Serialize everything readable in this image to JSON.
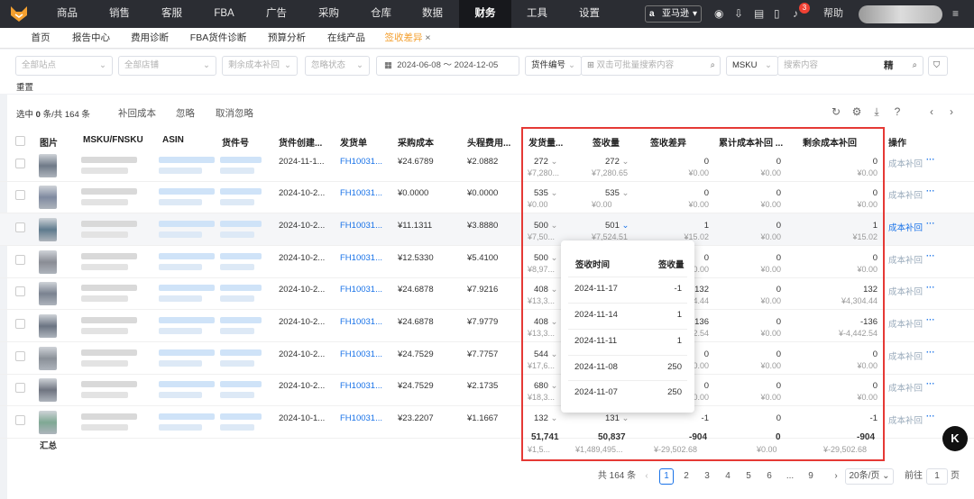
{
  "nav": {
    "items": [
      "商品",
      "销售",
      "客服",
      "FBA",
      "广告",
      "采购",
      "仓库",
      "数据",
      "财务",
      "工具",
      "设置"
    ],
    "active": "财务",
    "region": "亚马逊",
    "help": "帮助",
    "notif_count": "3"
  },
  "tabs": {
    "items": [
      "首页",
      "报告中心",
      "费用诊断",
      "FBA货件诊断",
      "预算分析",
      "在线产品",
      "签收差异"
    ],
    "active_close": "×"
  },
  "filters": {
    "site": "全部站点",
    "shop": "全部店铺",
    "remaining": "剩余成本补回",
    "ignore": "忽略状态",
    "date_start": "2024-06-08",
    "date_sep": "～",
    "date_end": "2024-12-05",
    "shipment_field": "货件编号",
    "batch_placeholder": "双击可批量搜索内容",
    "msku_field": "MSKU",
    "search_placeholder": "搜索内容",
    "exact": "精",
    "reset": "重置"
  },
  "toolbar": {
    "selected": "选中",
    "selected_count": "0",
    "selected_total": "条/共 164 条",
    "recover": "补回成本",
    "ignore": "忽略",
    "cancel_ignore": "取消忽略"
  },
  "columns": [
    "图片",
    "MSKU/FNSKU",
    "ASIN",
    "货件号",
    "货件创建...",
    "发货单",
    "采购成本",
    "头程费用...",
    "发货量...",
    "签收量",
    "签收差异",
    "累计成本补回 ...",
    "剩余成本补回",
    "操作"
  ],
  "rows": [
    {
      "created": "2024-11-1...",
      "order": "FH10031...",
      "cost": "¥24.6789",
      "freight": "¥2.0882",
      "ship": "272",
      "ship_amt": "¥7,280...",
      "recv": "272",
      "recv_amt": "¥7,280.65",
      "diff": "0",
      "diff_amt": "¥0.00",
      "cum": "0",
      "cum_amt": "¥0.00",
      "rem": "0",
      "rem_amt": "¥0.00",
      "op": "成本补回"
    },
    {
      "created": "2024-10-2...",
      "order": "FH10031...",
      "cost": "¥0.0000",
      "freight": "¥0.0000",
      "ship": "535",
      "ship_amt": "¥0.00",
      "recv": "535",
      "recv_amt": "¥0.00",
      "diff": "0",
      "diff_amt": "¥0.00",
      "cum": "0",
      "cum_amt": "¥0.00",
      "rem": "0",
      "rem_amt": "¥0.00",
      "op": "成本补回"
    },
    {
      "created": "2024-10-2...",
      "order": "FH10031...",
      "cost": "¥11.1311",
      "freight": "¥3.8880",
      "ship": "500",
      "ship_amt": "¥7,50...",
      "recv": "501",
      "recv_amt": "¥7,524.51",
      "diff": "1",
      "diff_amt": "¥15.02",
      "cum": "0",
      "cum_amt": "¥0.00",
      "rem": "1",
      "rem_amt": "¥15.02",
      "op": "成本补回"
    },
    {
      "created": "2024-10-2...",
      "order": "FH10031...",
      "cost": "¥12.5330",
      "freight": "¥5.4100",
      "ship": "500",
      "ship_amt": "¥8,97...",
      "recv": "",
      "recv_amt": "",
      "diff": "0",
      "diff_amt": "¥0.00",
      "cum": "0",
      "cum_amt": "¥0.00",
      "rem": "0",
      "rem_amt": "¥0.00",
      "op": "成本补回"
    },
    {
      "created": "2024-10-2...",
      "order": "FH10031...",
      "cost": "¥24.6878",
      "freight": "¥7.9216",
      "ship": "408",
      "ship_amt": "¥13,3...",
      "recv": "",
      "recv_amt": "",
      "diff": "132",
      "diff_amt": "¥4,304.44",
      "cum": "0",
      "cum_amt": "¥0.00",
      "rem": "132",
      "rem_amt": "¥4,304.44",
      "op": "成本补回"
    },
    {
      "created": "2024-10-2...",
      "order": "FH10031...",
      "cost": "¥24.6878",
      "freight": "¥7.9779",
      "ship": "408",
      "ship_amt": "¥13,3...",
      "recv": "",
      "recv_amt": "",
      "diff": "-136",
      "diff_amt": "¥-4,442.54",
      "cum": "0",
      "cum_amt": "¥0.00",
      "rem": "-136",
      "rem_amt": "¥-4,442.54",
      "op": "成本补回"
    },
    {
      "created": "2024-10-2...",
      "order": "FH10031...",
      "cost": "¥24.7529",
      "freight": "¥7.7757",
      "ship": "544",
      "ship_amt": "¥17,6...",
      "recv": "",
      "recv_amt": "",
      "diff": "0",
      "diff_amt": "¥0.00",
      "cum": "0",
      "cum_amt": "¥0.00",
      "rem": "0",
      "rem_amt": "¥0.00",
      "op": "成本补回"
    },
    {
      "created": "2024-10-2...",
      "order": "FH10031...",
      "cost": "¥24.7529",
      "freight": "¥2.1735",
      "ship": "680",
      "ship_amt": "¥18,3...",
      "recv": "",
      "recv_amt": "",
      "diff": "0",
      "diff_amt": "¥0.00",
      "cum": "0",
      "cum_amt": "¥0.00",
      "rem": "0",
      "rem_amt": "¥0.00",
      "op": "成本补回"
    },
    {
      "created": "2024-10-1...",
      "order": "FH10031...",
      "cost": "¥23.2207",
      "freight": "¥1.1667",
      "ship": "132",
      "ship_amt": "",
      "recv": "131",
      "recv_amt": "",
      "diff": "-1",
      "diff_amt": "",
      "cum": "0",
      "cum_amt": "",
      "rem": "-1",
      "rem_amt": "",
      "op": "成本补回"
    }
  ],
  "summary": {
    "label": "汇总",
    "ship": "51,741",
    "ship_amt": "¥1,5...",
    "recv": "50,837",
    "recv_amt": "¥1,489,495...",
    "diff": "-904",
    "diff_amt": "¥-29,502.68",
    "cum": "0",
    "cum_amt": "¥0.00",
    "rem": "-904",
    "rem_amt": "¥-29,502.68"
  },
  "popup": {
    "col1": "签收时间",
    "col2": "签收量",
    "rows": [
      {
        "date": "2024-11-17",
        "qty": "-1"
      },
      {
        "date": "2024-11-14",
        "qty": "1"
      },
      {
        "date": "2024-11-11",
        "qty": "1"
      },
      {
        "date": "2024-11-08",
        "qty": "250"
      },
      {
        "date": "2024-11-07",
        "qty": "250"
      }
    ]
  },
  "pager": {
    "total": "共 164 条",
    "pages": [
      "1",
      "2",
      "3",
      "4",
      "5",
      "6",
      "...",
      "9"
    ],
    "current": "1",
    "per_page": "20条/页",
    "goto": "前往",
    "goto_value": "1",
    "page_suffix": "页"
  },
  "colors": {
    "accent": "#f4a030",
    "link": "#1a73e8",
    "highlight": "#e53935",
    "nav_bg": "#2b2d33"
  }
}
